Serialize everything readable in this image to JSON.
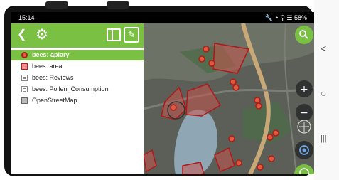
{
  "status_bar": {
    "time": "15:14",
    "indicators": "🔧 ◔ ⚲ ☰ 58%"
  },
  "toolbar": {
    "back_icon": "arrow-back-icon",
    "settings_icon": "gear-icon",
    "map_icon": "map-icon",
    "edit_icon": "pencil-icon",
    "color": "#7ac143"
  },
  "layers": [
    {
      "label": "bees: apiary",
      "icon": "point-layer-icon",
      "selected": true
    },
    {
      "label": "bees: area",
      "icon": "polygon-layer-icon",
      "selected": false
    },
    {
      "label": "bees: Reviews",
      "icon": "table-layer-icon",
      "selected": false
    },
    {
      "label": "bees: Pollen_Consumption",
      "icon": "table-layer-icon",
      "selected": false
    },
    {
      "label": "OpenStreetMap",
      "icon": "raster-layer-icon",
      "selected": false
    }
  ],
  "map_controls": {
    "search": "search-icon",
    "zoom_in": "+",
    "zoom_out": "−",
    "gps": "gps-icon",
    "add": "add-icon"
  },
  "nav_bar": {
    "back": "<",
    "home": "○",
    "recents": "|||"
  }
}
